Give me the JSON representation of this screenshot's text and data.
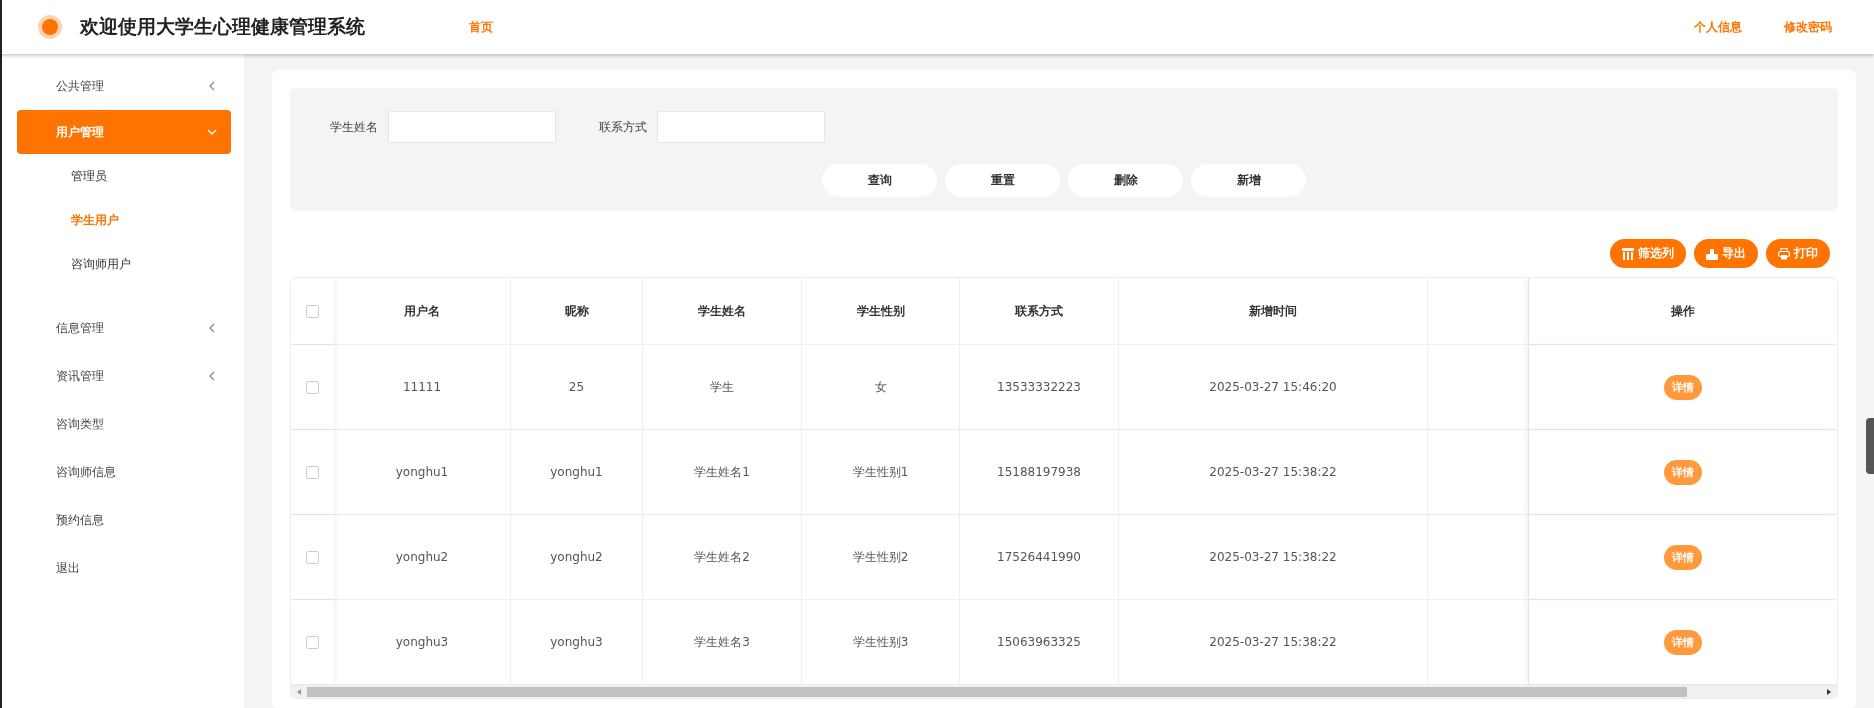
{
  "header": {
    "title": "欢迎使用大学生心理健康管理系统",
    "nav": [
      {
        "label": "首页"
      }
    ],
    "links": [
      {
        "label": "个人信息"
      },
      {
        "label": "修改密码"
      }
    ]
  },
  "sidebar": {
    "items": [
      {
        "label": "公共管理",
        "kind": "group",
        "expanded": false,
        "selected": false
      },
      {
        "label": "用户管理",
        "kind": "group",
        "expanded": true,
        "selected": true,
        "children": [
          {
            "label": "管理员",
            "selected": false
          },
          {
            "label": "学生用户",
            "selected": true
          },
          {
            "label": "咨询师用户",
            "selected": false
          }
        ]
      },
      {
        "label": "信息管理",
        "kind": "group",
        "expanded": false,
        "selected": false
      },
      {
        "label": "资讯管理",
        "kind": "group",
        "expanded": false,
        "selected": false
      },
      {
        "label": "咨询类型",
        "kind": "link",
        "selected": false
      },
      {
        "label": "咨询师信息",
        "kind": "link",
        "selected": false
      },
      {
        "label": "预约信息",
        "kind": "link",
        "selected": false
      },
      {
        "label": "退出",
        "kind": "link",
        "selected": false
      }
    ]
  },
  "search": {
    "fields": [
      {
        "label": "学生姓名"
      },
      {
        "label": "联系方式"
      }
    ],
    "buttons": [
      "查询",
      "重置",
      "删除",
      "新增"
    ]
  },
  "toolbar": [
    {
      "label": "筛选列",
      "kind": "columns"
    },
    {
      "label": "导出",
      "kind": "export"
    },
    {
      "label": "打印",
      "kind": "print"
    }
  ],
  "table": {
    "all_checked": false,
    "columns": [
      "用户名",
      "昵称",
      "学生姓名",
      "学生性别",
      "联系方式",
      "新增时间"
    ],
    "action_column": "操作",
    "rows": [
      {
        "checked": false,
        "cells": [
          "11111",
          "25",
          "学生",
          "女",
          "13533332223",
          "2025-03-27 15:46:20"
        ],
        "action": "详情"
      },
      {
        "checked": false,
        "cells": [
          "yonghu1",
          "yonghu1",
          "学生姓名1",
          "学生性别1",
          "15188197938",
          "2025-03-27 15:38:22"
        ],
        "action": "详情"
      },
      {
        "checked": false,
        "cells": [
          "yonghu2",
          "yonghu2",
          "学生姓名2",
          "学生性别2",
          "17526441990",
          "2025-03-27 15:38:22"
        ],
        "action": "详情"
      },
      {
        "checked": false,
        "cells": [
          "yonghu3",
          "yonghu3",
          "学生姓名3",
          "学生性别3",
          "15063963325",
          "2025-03-27 15:38:22"
        ],
        "action": "详情"
      }
    ]
  }
}
